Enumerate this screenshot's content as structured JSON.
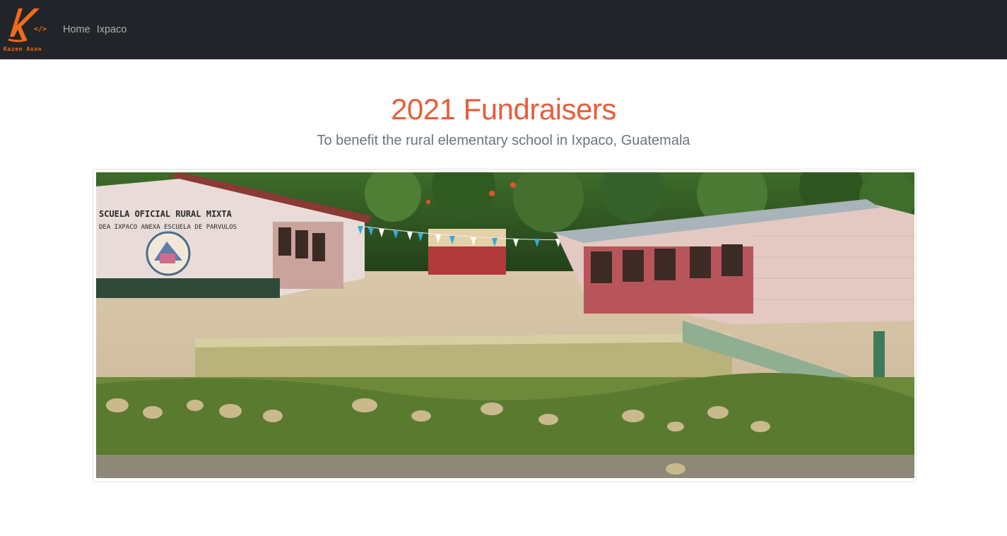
{
  "brand": {
    "text": "Kazen Axon",
    "logo_letter": "K",
    "logo_glyph": "</>",
    "accent_color": "#f26a1b"
  },
  "nav": {
    "links": [
      {
        "label": "Home"
      },
      {
        "label": "Ixpaco"
      }
    ]
  },
  "hero": {
    "title": "2021 Fundraisers",
    "subtitle": "To benefit the rural elementary school in Ixpaco, Guatemala",
    "title_color": "#e85d3a"
  },
  "photo": {
    "sign_line1": "SCUELA OFICIAL RURAL MIXTA",
    "sign_line2": "DEA IXPACO ANEXA ESCUELA DE PARVULOS"
  }
}
